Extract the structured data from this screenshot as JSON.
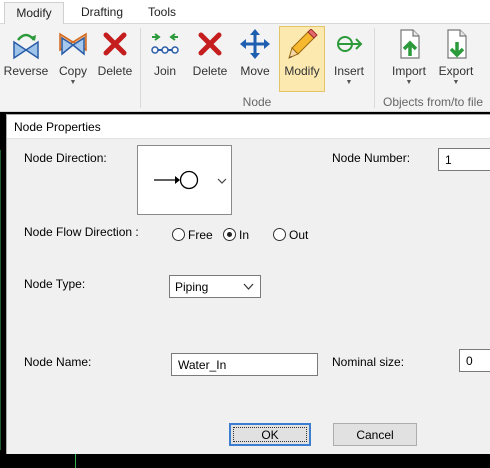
{
  "ribbon": {
    "tabs": [
      {
        "label": "Modify",
        "active": true
      },
      {
        "label": "Drafting",
        "active": false
      },
      {
        "label": "Tools",
        "active": false
      }
    ],
    "buttons": {
      "reverse": "Reverse",
      "copy": "Copy",
      "delete1": "Delete",
      "join": "Join",
      "delete2": "Delete",
      "move": "Move",
      "modify": "Modify",
      "insert": "Insert",
      "import": "Import",
      "export": "Export"
    },
    "dropdown_glyph": "▼",
    "groups": {
      "node": "Node",
      "objects": "Objects from/to file"
    }
  },
  "dialog": {
    "title": "Node Properties",
    "direction_label": "Node Direction:",
    "number_label": "Node Number:",
    "number_value": "1",
    "flow_label": "Node Flow Direction :",
    "flow_options": [
      "Free",
      "In",
      "Out"
    ],
    "flow_selected": "In",
    "type_label": "Node Type:",
    "type_value": "Piping",
    "name_label": "Node Name:",
    "name_value": "Water_In",
    "size_label": "Nominal size:",
    "size_value": "0",
    "ok_label": "OK",
    "cancel_label": "Cancel"
  },
  "colors": {
    "ribbon_bg": "#f3f3f3",
    "dialog_bg": "#f0f0f0",
    "selected_button": "#fbe9b0",
    "canvas_bg": "#000000",
    "default_button_border": "#3c7fd0"
  }
}
